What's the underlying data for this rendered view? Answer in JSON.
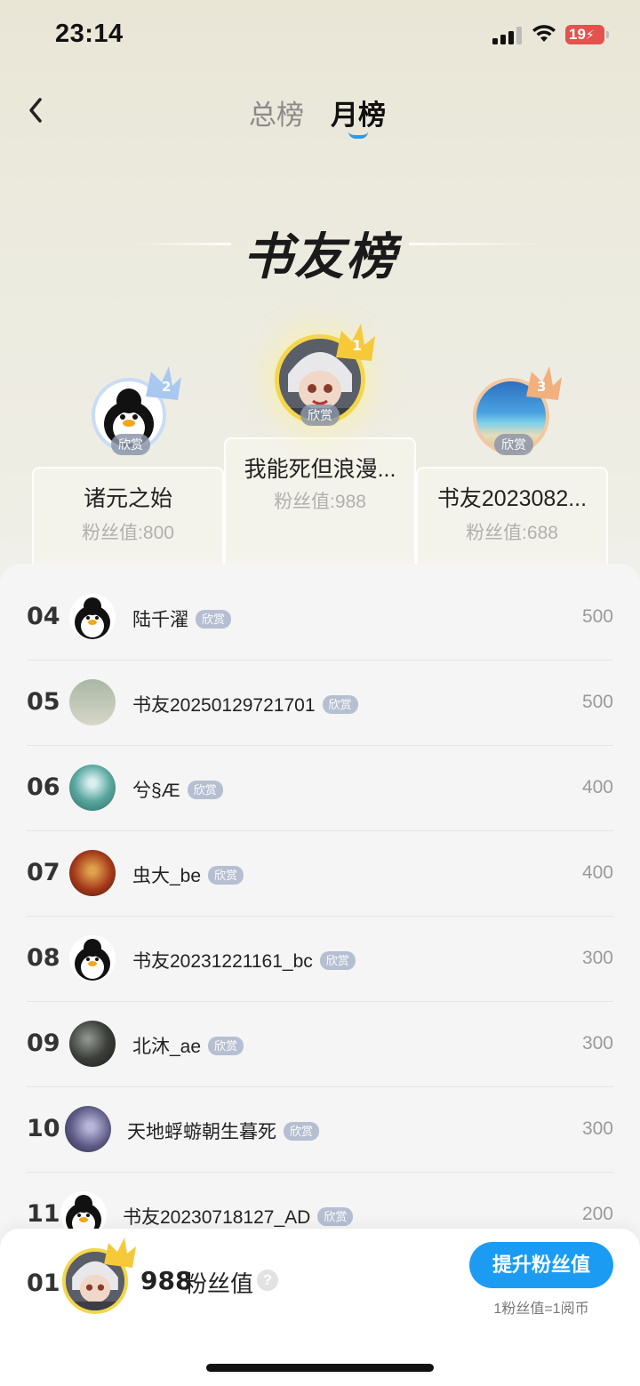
{
  "status": {
    "time": "23:14",
    "battery": "19"
  },
  "tabs": [
    {
      "label": "总榜"
    },
    {
      "label": "月榜"
    }
  ],
  "title": "书友榜",
  "podium": {
    "first": {
      "rank": "1",
      "name": "我能死但浪漫...",
      "fans": "粉丝值:988",
      "badge": "欣赏"
    },
    "second": {
      "rank": "2",
      "name": "诸元之始",
      "fans": "粉丝值:800",
      "badge": "欣赏"
    },
    "third": {
      "rank": "3",
      "name": "书友2023082...",
      "fans": "粉丝值:688",
      "badge": "欣赏"
    }
  },
  "list": [
    {
      "rank": "04",
      "name": "陆千濯",
      "badge": "欣赏",
      "value": "500",
      "avatar": "penguin-avatar"
    },
    {
      "rank": "05",
      "name": "书友20250129721701",
      "badge": "欣赏",
      "value": "500",
      "avatar": "figure-avatar"
    },
    {
      "rank": "06",
      "name": "兮§Æ",
      "badge": "欣赏",
      "value": "400",
      "avatar": "forest-avatar"
    },
    {
      "rank": "07",
      "name": "虫大_be",
      "badge": "欣赏",
      "value": "400",
      "avatar": "red-avatar"
    },
    {
      "rank": "08",
      "name": "书友20231221161_bc",
      "badge": "欣赏",
      "value": "300",
      "avatar": "penguin-avatar"
    },
    {
      "rank": "09",
      "name": "北沐_ae",
      "badge": "欣赏",
      "value": "300",
      "avatar": "dark-avatar"
    },
    {
      "rank": "10",
      "name": "天地蜉蝣朝生暮死",
      "badge": "欣赏",
      "value": "300",
      "avatar": "purple-avatar"
    },
    {
      "rank": "11",
      "name": "书友20230718127_AD",
      "badge": "欣赏",
      "value": "200",
      "avatar": "penguin-avatar"
    }
  ],
  "me": {
    "rank": "01",
    "fans_value": "988",
    "fans_label": "粉丝值",
    "help": "?",
    "boost_label": "提升粉丝值",
    "rate": "1粉丝值=1阅币"
  },
  "colors": {
    "accent": "#1b9cf2",
    "gold": "#f3d64a",
    "silver": "#b9d2f2",
    "bronze": "#f2b07e"
  }
}
